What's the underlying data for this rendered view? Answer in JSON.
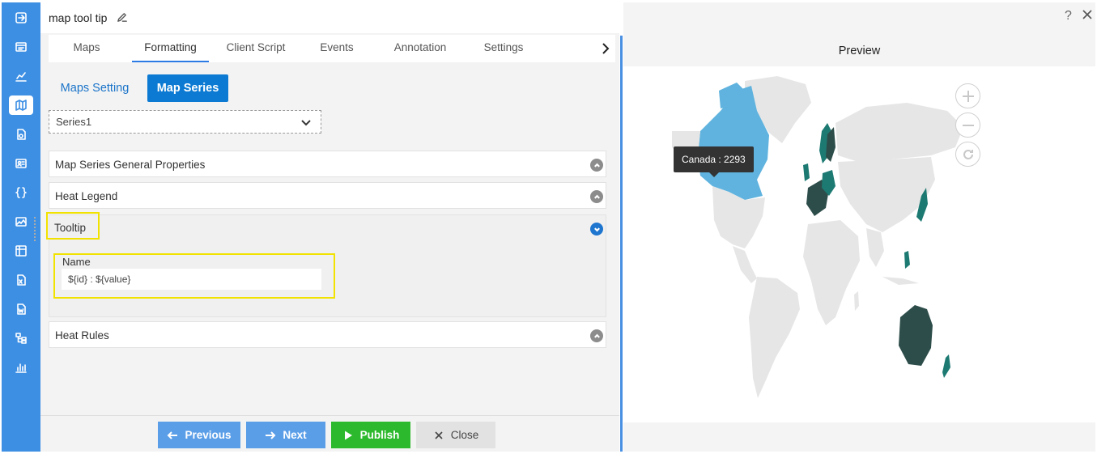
{
  "header": {
    "title": "map tool tip",
    "edit_icon": "pencil-icon"
  },
  "tabs": [
    {
      "label": "Maps"
    },
    {
      "label": "Formatting",
      "active": true
    },
    {
      "label": "Client Script"
    },
    {
      "label": "Events"
    },
    {
      "label": "Annotation"
    },
    {
      "label": "Settings"
    }
  ],
  "subtabs": {
    "maps_setting": "Maps Setting",
    "map_series": "Map Series"
  },
  "series_select": {
    "value": "Series1"
  },
  "sections": {
    "general": "Map Series General Properties",
    "heat_legend": "Heat Legend",
    "tooltip": "Tooltip",
    "heat_rules": "Heat Rules"
  },
  "tooltip_form": {
    "name_label": "Name",
    "name_value": "${id} : ${value}"
  },
  "footer": {
    "previous": "Previous",
    "next": "Next",
    "publish": "Publish",
    "close": "Close"
  },
  "preview": {
    "title": "Preview",
    "help": "?",
    "map_tooltip": "Canada : 2293"
  },
  "colors": {
    "rail": "#3d8fe4",
    "accent": "#0c7ad3",
    "publish": "#2db92d",
    "highlight": "#f2e200",
    "heat_low": "#5fb3de",
    "heat_mid": "#1d7a72",
    "heat_high": "#2d4d4a",
    "land": "#e6e6e6"
  },
  "rail_icons": [
    "export-icon",
    "table-icon",
    "line-chart-icon",
    "map-icon",
    "document-icon",
    "id-card-icon",
    "code-braces-icon",
    "image-chart-icon",
    "pivot-icon",
    "excel-icon",
    "word-icon",
    "tree-icon",
    "bar-chart-icon"
  ]
}
